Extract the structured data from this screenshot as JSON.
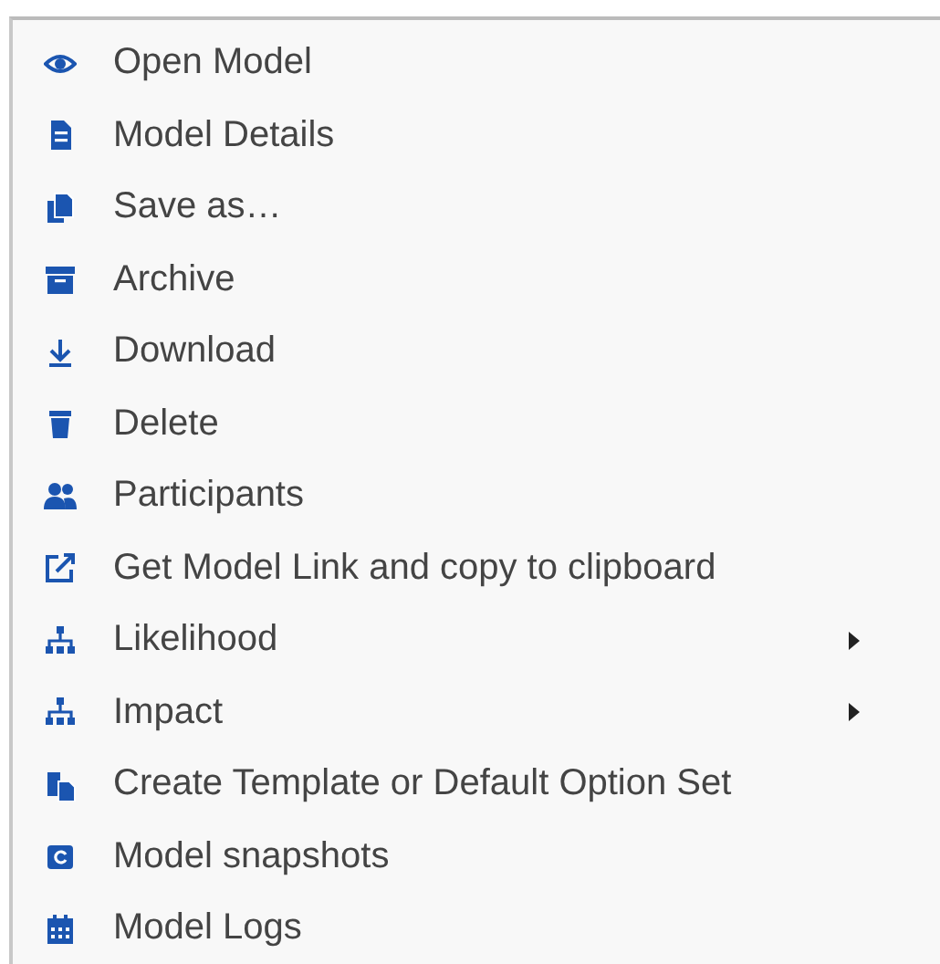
{
  "menu": {
    "items": [
      {
        "label": "Open Model",
        "submenu": false
      },
      {
        "label": "Model Details",
        "submenu": false
      },
      {
        "label": "Save as…",
        "submenu": false
      },
      {
        "label": "Archive",
        "submenu": false
      },
      {
        "label": "Download",
        "submenu": false
      },
      {
        "label": "Delete",
        "submenu": false
      },
      {
        "label": "Participants",
        "submenu": false
      },
      {
        "label": "Get Model Link and copy to clipboard",
        "submenu": false
      },
      {
        "label": "Likelihood",
        "submenu": true
      },
      {
        "label": "Impact",
        "submenu": true
      },
      {
        "label": "Create Template or Default Option Set",
        "submenu": false
      },
      {
        "label": "Model snapshots",
        "submenu": false
      },
      {
        "label": "Model Logs",
        "submenu": false
      }
    ]
  }
}
